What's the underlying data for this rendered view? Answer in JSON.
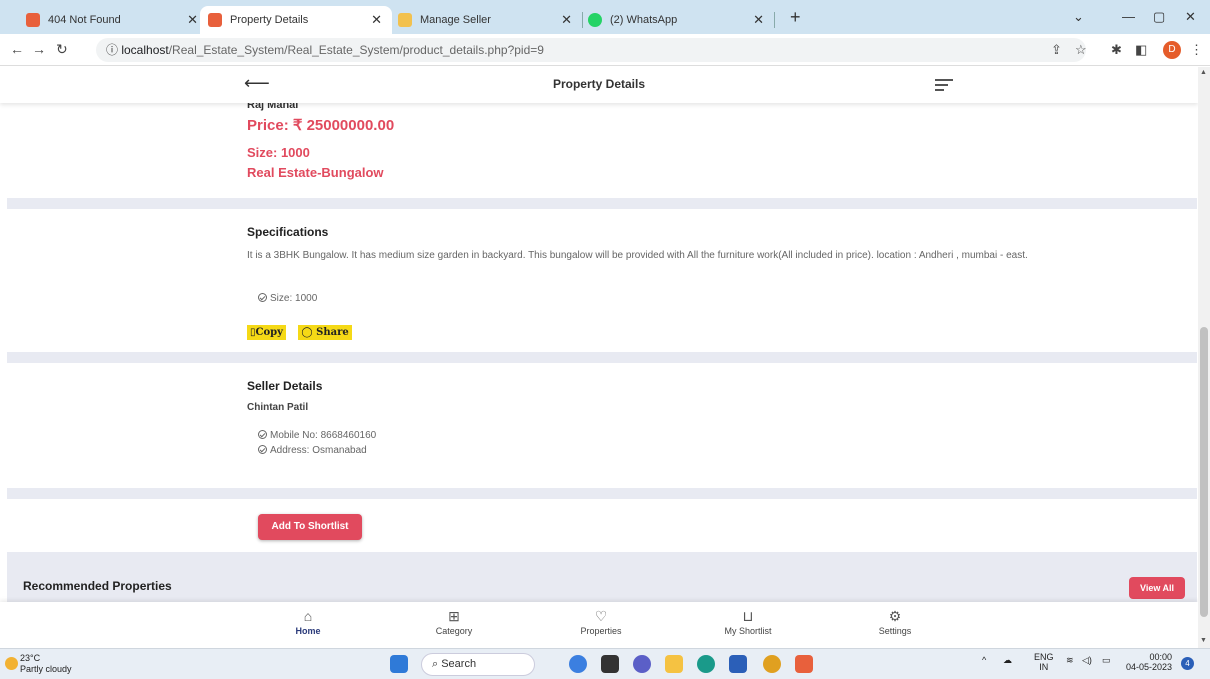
{
  "browser": {
    "tabs": [
      {
        "title": "404 Not Found",
        "fav_color": "#e8603c",
        "active": false
      },
      {
        "title": "Property Details",
        "fav_color": "#e8603c",
        "active": true
      },
      {
        "title": "Manage Seller",
        "fav_color": "#f2c14e",
        "active": false
      },
      {
        "title": "(2) WhatsApp",
        "fav_color": "#25d366",
        "active": false
      }
    ],
    "url_host": "localhost",
    "url_path": "/Real_Estate_System/Real_Estate_System/product_details.php?pid=9",
    "profile_initial": "D"
  },
  "app": {
    "title": "Property Details",
    "property": {
      "name": "Raj Mahal",
      "price": "Price: ₹ 25000000.00",
      "size": "Size: 1000",
      "category": "Real Estate-Bungalow"
    },
    "specifications": {
      "heading": "Specifications",
      "description": "It is a 3BHK Bungalow. It has medium size garden in backyard. This bungalow will be provided with All the furniture work(All included in price). location : Andheri , mumbai - east.",
      "size_item": "Size: 1000",
      "copy_label": "Copy",
      "share_label": "Share"
    },
    "seller": {
      "heading": "Seller Details",
      "name": "Chintan Patil",
      "mobile": "Mobile No: 8668460160",
      "address": "Address: Osmanabad"
    },
    "add_shortlist_label": "Add To Shortlist",
    "recommended_heading": "Recommended Properties",
    "view_all_label": "View All",
    "bottom_nav": [
      {
        "label": "Home",
        "icon": "home-icon",
        "active": true
      },
      {
        "label": "Category",
        "icon": "basket-icon",
        "active": false
      },
      {
        "label": "Properties",
        "icon": "heart-icon",
        "active": false
      },
      {
        "label": "My Shortlist",
        "icon": "cart-icon",
        "active": false
      },
      {
        "label": "Settings",
        "icon": "gear-icon",
        "active": false
      }
    ],
    "colors": {
      "accent": "#e14a5e",
      "band": "#e8eaf2",
      "button_yellow": "#f5d916"
    }
  },
  "taskbar": {
    "temperature": "23°C",
    "weather": "Partly cloudy",
    "search_label": "Search",
    "lang_top": "ENG",
    "lang_bottom": "IN",
    "time": "00:00",
    "date": "04-05-2023",
    "notifications": "4"
  }
}
